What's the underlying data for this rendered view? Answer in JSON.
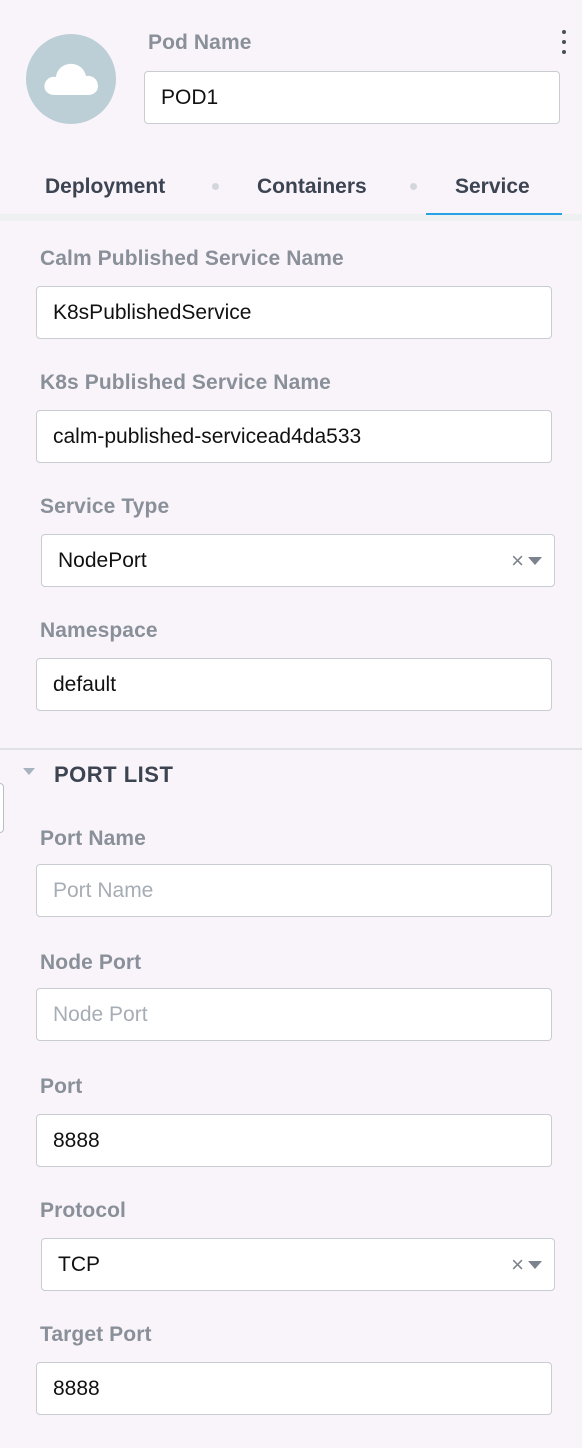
{
  "header": {
    "avatar_icon": "cloud-icon",
    "menu_icon": "kebab-menu-icon",
    "pod_name_label": "Pod Name",
    "pod_name_value": "POD1"
  },
  "tabs": [
    {
      "label": "Deployment",
      "active": false
    },
    {
      "label": "Containers",
      "active": false
    },
    {
      "label": "Service",
      "active": true
    }
  ],
  "service": {
    "calm_name_label": "Calm Published Service Name",
    "calm_name_value": "K8sPublishedService",
    "k8s_name_label": "K8s Published Service Name",
    "k8s_name_value": "calm-published-servicead4da533",
    "service_type_label": "Service Type",
    "service_type_value": "NodePort",
    "namespace_label": "Namespace",
    "namespace_value": "default"
  },
  "port_list": {
    "title": "PORT LIST",
    "port_name_label": "Port Name",
    "port_name_value": "",
    "port_name_placeholder": "Port Name",
    "node_port_label": "Node Port",
    "node_port_value": "",
    "node_port_placeholder": "Node Port",
    "port_label": "Port",
    "port_value": "8888",
    "protocol_label": "Protocol",
    "protocol_value": "TCP",
    "target_port_label": "Target Port",
    "target_port_value": "8888"
  },
  "icons": {
    "clear": "×",
    "dropdown": "chevron-down-icon"
  },
  "colors": {
    "accent": "#27a0e6",
    "background": "#f9f4fa",
    "label": "#8a9099",
    "avatar": "#bccfd6"
  }
}
